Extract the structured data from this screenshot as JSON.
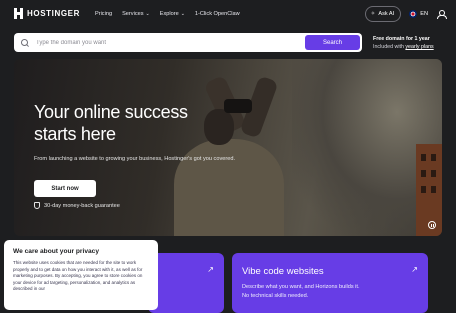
{
  "nav": {
    "logo_text": "HOSTINGER",
    "items": [
      {
        "label": "Pricing",
        "dropdown": false
      },
      {
        "label": "Services",
        "dropdown": true
      },
      {
        "label": "Explore",
        "dropdown": true
      },
      {
        "label": "1-Click OpenClaw",
        "dropdown": false
      }
    ],
    "ask_ai": "Ask AI",
    "lang": "EN"
  },
  "search": {
    "placeholder": "Type the domain you want",
    "button": "Search"
  },
  "promo": {
    "title": "Free domain for 1 year",
    "subtitle_prefix": "Included with",
    "subtitle_link": "yearly plans"
  },
  "hero": {
    "title": "Your online success starts here",
    "subtitle": "From launching a website to growing your business, Hostinger's got you covered.",
    "cta": "Start now",
    "guarantee": "30-day money-back guarantee"
  },
  "cards": [
    {
      "title": "",
      "desc": ""
    },
    {
      "title": "Vibe code websites",
      "desc": "Describe what you want, and Horizons builds it. No technical skills needed."
    }
  ],
  "cookie": {
    "title": "We care about your privacy",
    "body": "This website uses cookies that are needed for the site to work properly and to get data on how you interact with it, as well as for marketing purposes. By accepting, you agree to store cookies on your device for ad targeting, personalization, and analytics as described in our"
  },
  "colors": {
    "accent": "#673de6",
    "bg": "#1d1e20"
  }
}
